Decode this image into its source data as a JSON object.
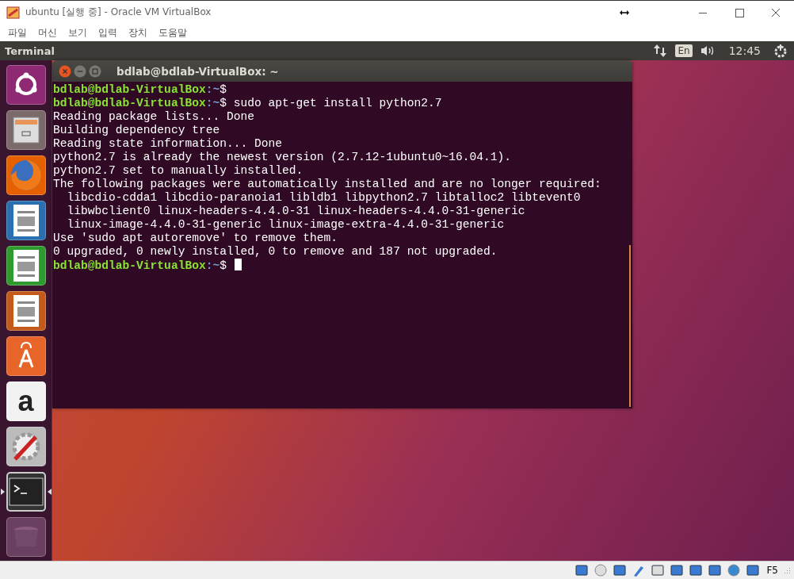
{
  "host_window": {
    "title": "ubuntu [실행 중] - Oracle VM VirtualBox",
    "menu": [
      "파일",
      "머신",
      "보기",
      "입력",
      "장치",
      "도움말"
    ]
  },
  "top_panel": {
    "app_name": "Terminal",
    "keyboard_layout": "En",
    "clock": "12:45"
  },
  "launcher": [
    {
      "kind": "dash",
      "running": false
    },
    {
      "kind": "files",
      "running": false
    },
    {
      "kind": "firefox",
      "running": false
    },
    {
      "kind": "writer",
      "running": false
    },
    {
      "kind": "calc",
      "running": false
    },
    {
      "kind": "impress",
      "running": false
    },
    {
      "kind": "software",
      "running": false
    },
    {
      "kind": "amazon",
      "running": false,
      "glyph": "a"
    },
    {
      "kind": "settings",
      "running": false
    },
    {
      "kind": "terminal",
      "running": true
    },
    {
      "kind": "trash",
      "running": false
    }
  ],
  "terminal": {
    "title": "bdlab@bdlab-VirtualBox: ~",
    "cursor": true,
    "lines": [
      {
        "kind": "prompt",
        "user": "bdlab@bdlab-VirtualBox",
        "path": ":~",
        "text": "$"
      },
      {
        "kind": "prompt",
        "user": "bdlab@bdlab-VirtualBox",
        "path": ":~",
        "text": "$ sudo apt-get install python2.7"
      },
      {
        "kind": "output",
        "text": "Reading package lists... Done"
      },
      {
        "kind": "output",
        "text": "Building dependency tree"
      },
      {
        "kind": "output",
        "text": "Reading state information... Done"
      },
      {
        "kind": "output",
        "text": "python2.7 is already the newest version (2.7.12-1ubuntu0~16.04.1)."
      },
      {
        "kind": "output",
        "text": "python2.7 set to manually installed."
      },
      {
        "kind": "output",
        "text": "The following packages were automatically installed and are no longer required:"
      },
      {
        "kind": "output",
        "text": "  libcdio-cdda1 libcdio-paranoia1 libldb1 libpython2.7 libtalloc2 libtevent0"
      },
      {
        "kind": "output",
        "text": "  libwbclient0 linux-headers-4.4.0-31 linux-headers-4.4.0-31-generic"
      },
      {
        "kind": "output",
        "text": "  linux-image-4.4.0-31-generic linux-image-extra-4.4.0-31-generic"
      },
      {
        "kind": "output",
        "text": "Use 'sudo apt autoremove' to remove them."
      },
      {
        "kind": "output",
        "text": "0 upgraded, 0 newly installed, 0 to remove and 187 not upgraded."
      },
      {
        "kind": "prompt",
        "user": "bdlab@bdlab-VirtualBox",
        "path": ":~",
        "text": "$ "
      }
    ]
  },
  "status_bar": {
    "host_key": "F5"
  }
}
